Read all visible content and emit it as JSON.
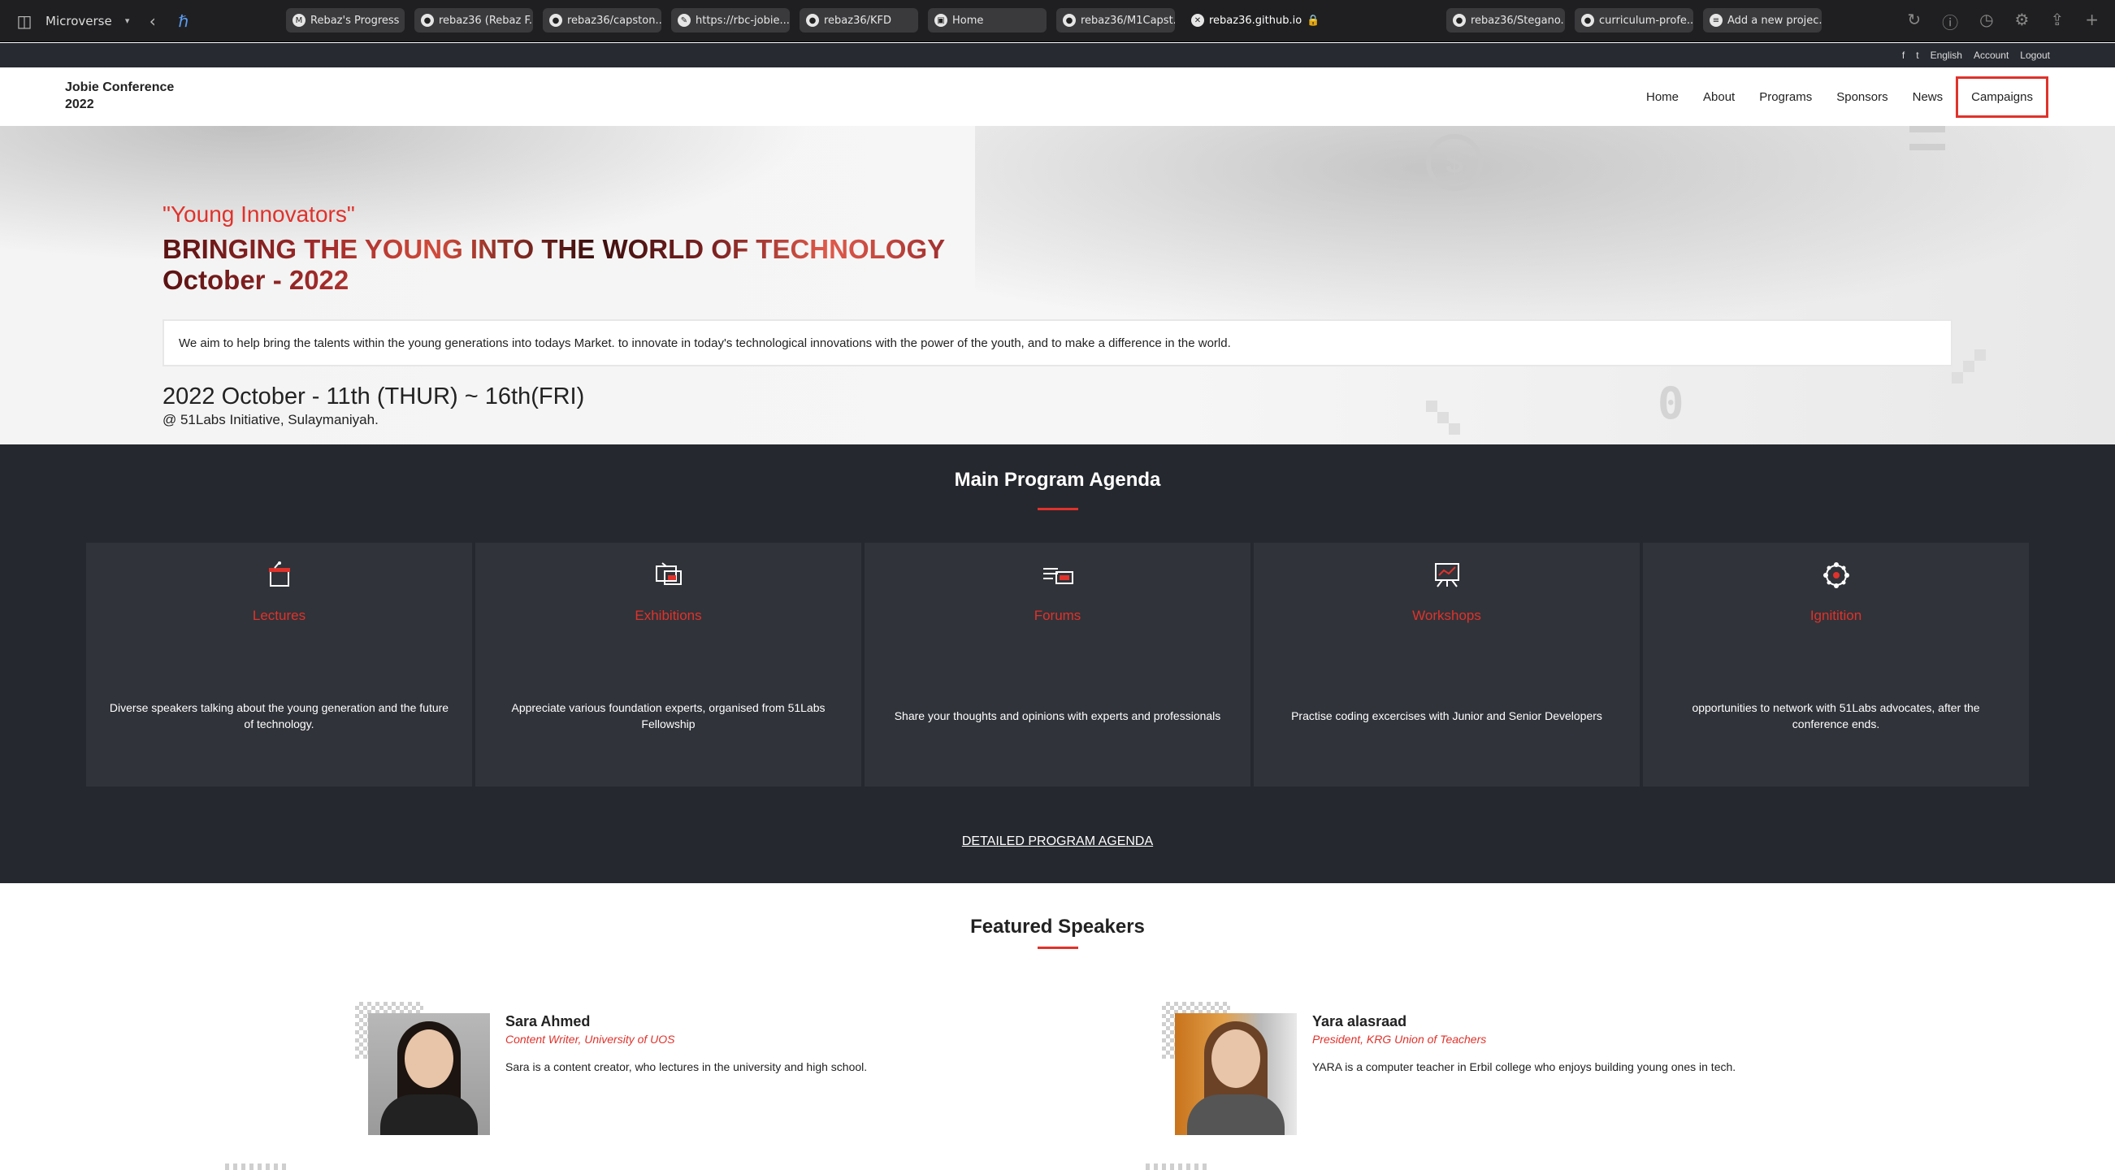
{
  "browser": {
    "profile": "Microverse",
    "tabs": [
      {
        "label": "Rebaz's Progress",
        "favicon": "M"
      },
      {
        "label": "rebaz36 (Rebaz F...",
        "favicon": "●"
      },
      {
        "label": "rebaz36/capston...",
        "favicon": "●"
      },
      {
        "label": "https://rbc-jobie....",
        "favicon": "✎"
      },
      {
        "label": "rebaz36/KFD",
        "favicon": "●"
      },
      {
        "label": "Home",
        "favicon": "▣"
      },
      {
        "label": "rebaz36/M1Capst...",
        "favicon": "●"
      },
      {
        "label": "rebaz36.github.io",
        "favicon": "✕"
      },
      {
        "label": "rebaz36/Stegano...",
        "favicon": "●"
      },
      {
        "label": "curriculum-profe...",
        "favicon": "●"
      },
      {
        "label": "Add a new projec...",
        "favicon": "≡"
      }
    ]
  },
  "util": {
    "facebook": "f",
    "twitter": "t",
    "language": "English",
    "account": "Account",
    "logout": "Logout"
  },
  "logo": {
    "line1": "Jobie Conference",
    "line2": "2022"
  },
  "nav": {
    "home": "Home",
    "about": "About",
    "programs": "Programs",
    "sponsors": "Sponsors",
    "news": "News",
    "campaigns": "Campaigns"
  },
  "hero": {
    "tagline": "\"Young Innovators\"",
    "headline1": "BRINGING THE YOUNG INTO THE WORLD OF TECHNOLOGY",
    "headline2": "October - 2022",
    "mission": "We aim to help bring the talents within the young generations into todays Market. to innovate in today's technological innovations with the power of the youth, and to make a difference in the world.",
    "dates": "2022 October - 11th (THUR) ~ 16th(FRI)",
    "venue": "@ 51Labs Initiative, Sulaymaniyah."
  },
  "agenda": {
    "title": "Main Program Agenda",
    "cards": [
      {
        "title": "Lectures",
        "icon": "lectern-icon",
        "desc": "Diverse speakers talking about the young generation and the future of technology."
      },
      {
        "title": "Exhibitions",
        "icon": "exhibition-icon",
        "desc": "Appreciate various foundation experts, organised from 51Labs Fellowship"
      },
      {
        "title": "Forums",
        "icon": "forum-icon",
        "desc": "Share your thoughts and opinions with experts and professionals"
      },
      {
        "title": "Workshops",
        "icon": "workshop-icon",
        "desc": "Practise coding excercises with Junior and Senior Developers"
      },
      {
        "title": "Ignitition",
        "icon": "network-icon",
        "desc": "opportunities to network with 51Labs advocates, after the conference ends."
      }
    ],
    "detailed_link": "DETAILED PROGRAM AGENDA"
  },
  "speakers": {
    "title": "Featured Speakers",
    "list": [
      {
        "name": "Sara Ahmed",
        "role": "Content Writer, University of UOS",
        "desc": "Sara is a content creator, who lectures in the university and high school."
      },
      {
        "name": "Yara alasraad",
        "role": "President, KRG Union of Teachers",
        "desc": "YARA is a computer teacher in Erbil college who enjoys building young ones in tech."
      }
    ]
  },
  "colors": {
    "accent": "#e0322b",
    "dark": "#25282e",
    "card": "#303339"
  }
}
